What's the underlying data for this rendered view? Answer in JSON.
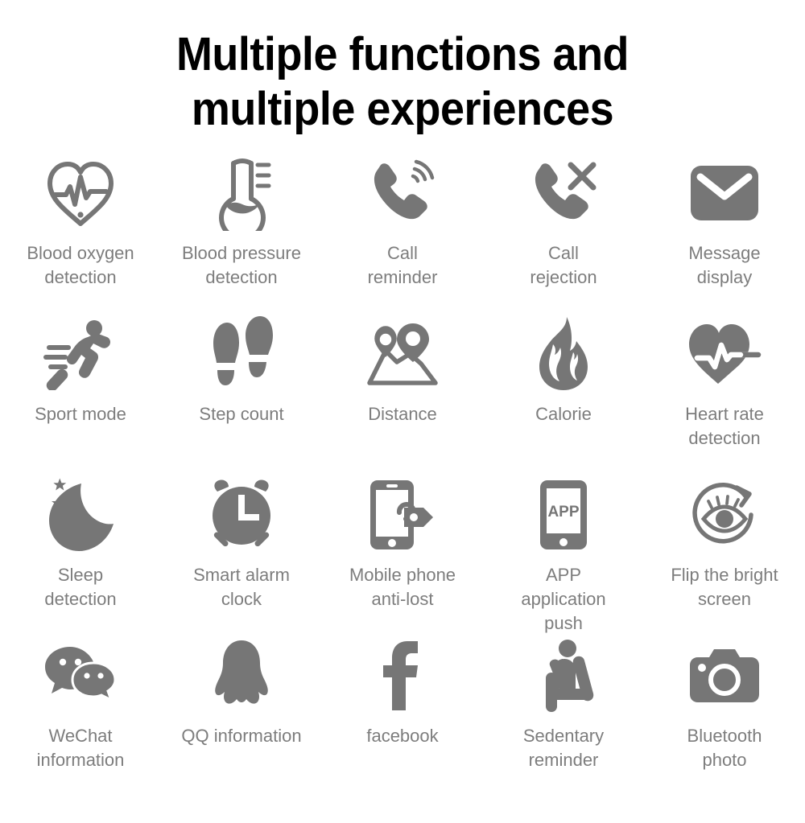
{
  "page": {
    "background_color": "#ffffff",
    "icon_color": "#767676",
    "label_color": "#7d7d7d",
    "title_color": "#000000"
  },
  "header": {
    "title_line_1": "Multiple functions and",
    "title_line_2": "multiple experiences"
  },
  "features": [
    {
      "icon": "heart-pulse-outline-icon",
      "label": "Blood oxygen\ndetection"
    },
    {
      "icon": "thermometer-icon",
      "label": "Blood pressure\ndetection"
    },
    {
      "icon": "phone-ring-icon",
      "label": "Call\nreminder"
    },
    {
      "icon": "phone-reject-icon",
      "label": "Call\nrejection"
    },
    {
      "icon": "envelope-icon",
      "label": "Message\ndisplay"
    },
    {
      "icon": "running-person-icon",
      "label": "Sport mode"
    },
    {
      "icon": "footprints-icon",
      "label": "Step count"
    },
    {
      "icon": "map-pins-icon",
      "label": "Distance"
    },
    {
      "icon": "flame-icon",
      "label": "Calorie"
    },
    {
      "icon": "heart-rate-solid-icon",
      "label": "Heart rate\ndetection"
    },
    {
      "icon": "moon-stars-icon",
      "label": "Sleep\ndetection"
    },
    {
      "icon": "alarm-clock-icon",
      "label": "Smart alarm\nclock"
    },
    {
      "icon": "phone-lock-icon",
      "label": "Mobile phone\nanti-lost"
    },
    {
      "icon": "phone-app-icon",
      "label": "APP\napplication\npush"
    },
    {
      "icon": "eye-rotate-icon",
      "label": "Flip the bright\nscreen"
    },
    {
      "icon": "wechat-bubbles-icon",
      "label": "WeChat\ninformation"
    },
    {
      "icon": "qq-penguin-icon",
      "label": "QQ information"
    },
    {
      "icon": "facebook-f-icon",
      "label": "facebook"
    },
    {
      "icon": "sedentary-person-icon",
      "label": "Sedentary\nreminder"
    },
    {
      "icon": "camera-icon",
      "label": "Bluetooth\nphoto"
    }
  ],
  "icon_texts": {
    "app_badge": "APP",
    "alarm_clock_face": "L"
  }
}
